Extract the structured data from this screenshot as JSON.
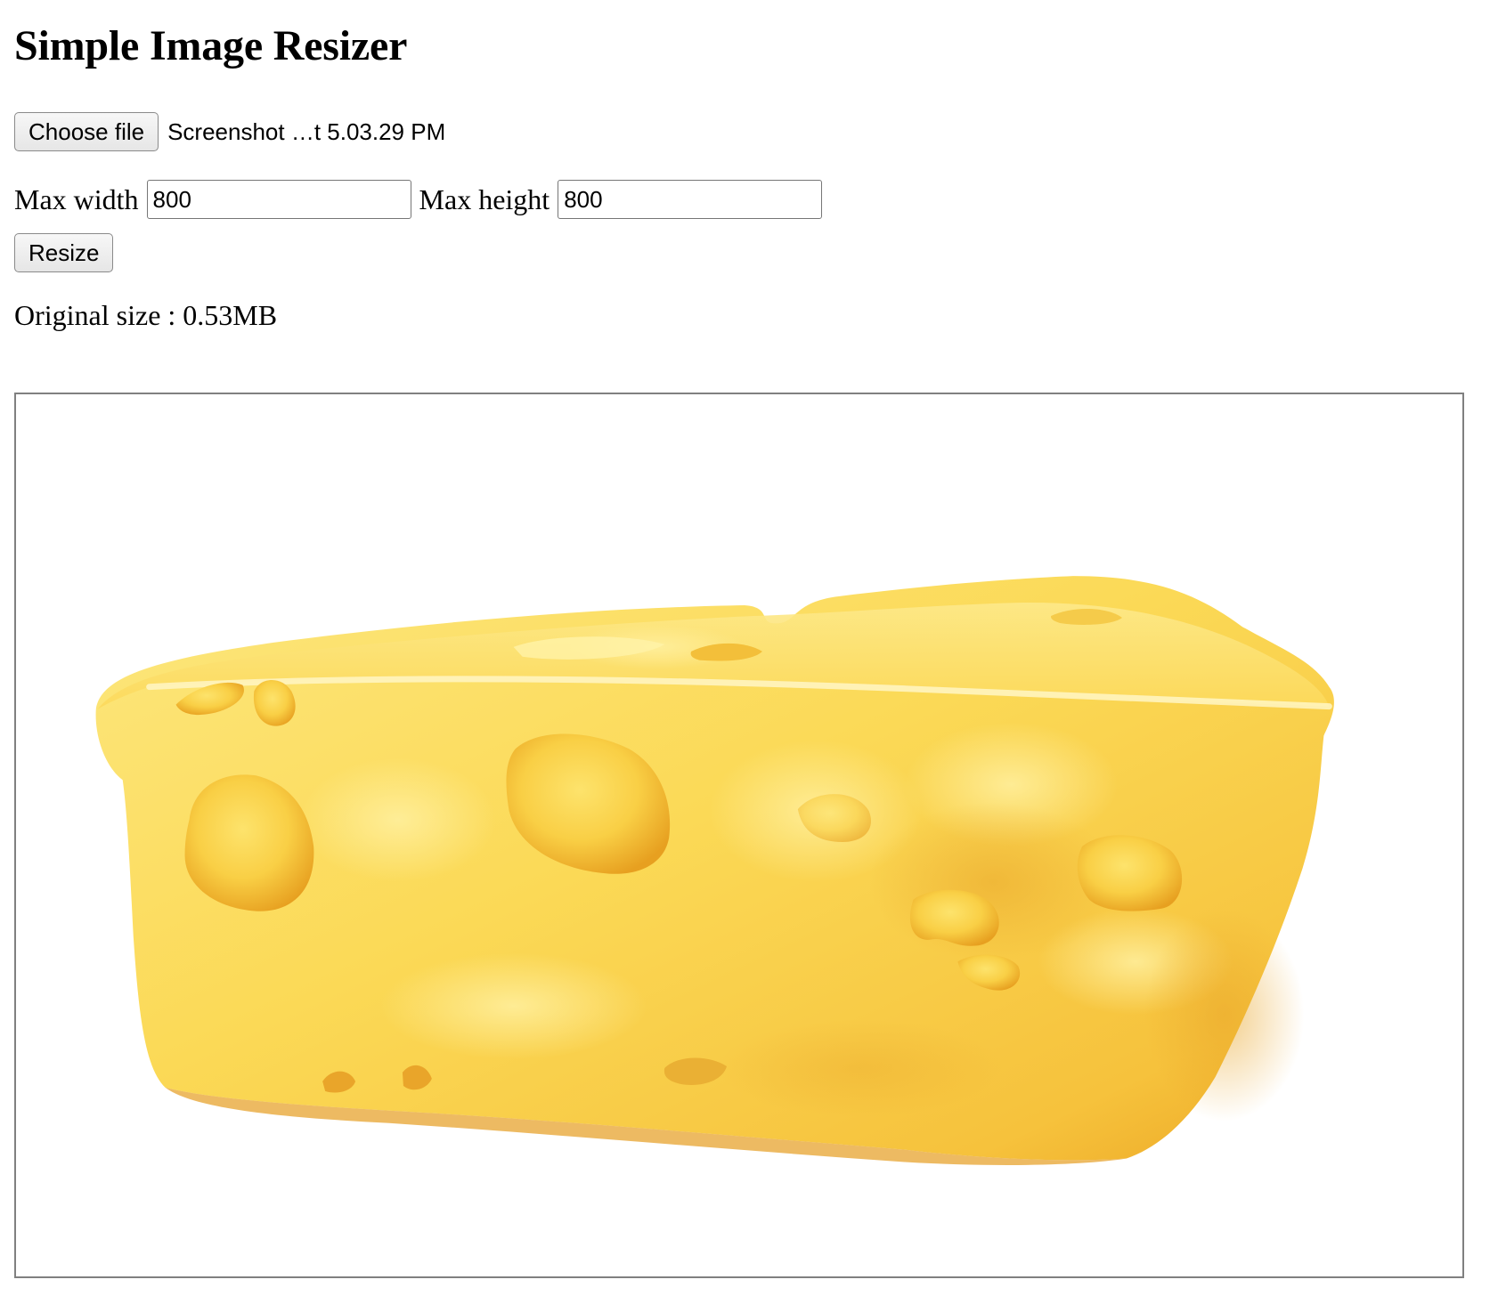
{
  "page": {
    "title": "Simple Image Resizer"
  },
  "file_picker": {
    "button_label": "Choose file",
    "selected_file": "Screenshot …t 5.03.29 PM"
  },
  "dimensions": {
    "max_width_label": "Max width",
    "max_width_value": "800",
    "max_height_label": "Max height",
    "max_height_value": "800"
  },
  "actions": {
    "resize_label": "Resize"
  },
  "info": {
    "original_size_label": "Original size",
    "original_size_separator": " : ",
    "original_size_value": "0.53MB"
  },
  "preview": {
    "image_subject": "wedge of yellow swiss cheese with holes",
    "image_icon": "cheese-image",
    "colors": {
      "cheese_light": "#fde77e",
      "cheese_mid": "#fad04a",
      "cheese_dark": "#eca624",
      "hole_shadow": "#e7a020",
      "frame_border": "#808080",
      "background": "#ffffff"
    }
  }
}
